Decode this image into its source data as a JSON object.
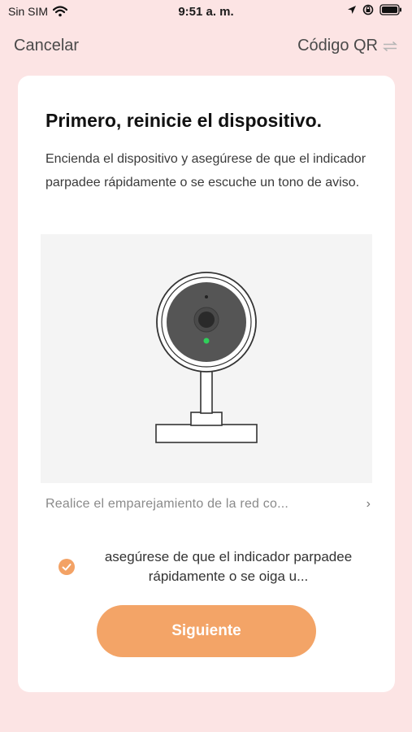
{
  "status_bar": {
    "carrier": "Sin SIM",
    "time": "9:51 a. m.",
    "icons": [
      "wifi-icon",
      "location-icon",
      "orientation-lock-icon",
      "battery-icon"
    ]
  },
  "nav": {
    "cancel": "Cancelar",
    "qr": "Código QR",
    "qr_icon": "switch-arrows-icon"
  },
  "card": {
    "title": "Primero, reinicie el dispositivo.",
    "description": "Encienda el dispositivo y asegúrese de que el indicador parpadee rápidamente o se escuche un tono de aviso.",
    "illustration": "camera-illustration",
    "pairing_link": "Realice el emparejamiento de la red co...",
    "confirm_text": "asegúrese de que el indicador parpadee rápidamente o se oiga u...",
    "confirm_checked": true,
    "next_button": "Siguiente"
  },
  "colors": {
    "background": "#fce4e4",
    "accent": "#f3a467",
    "led": "#2fd05a"
  }
}
